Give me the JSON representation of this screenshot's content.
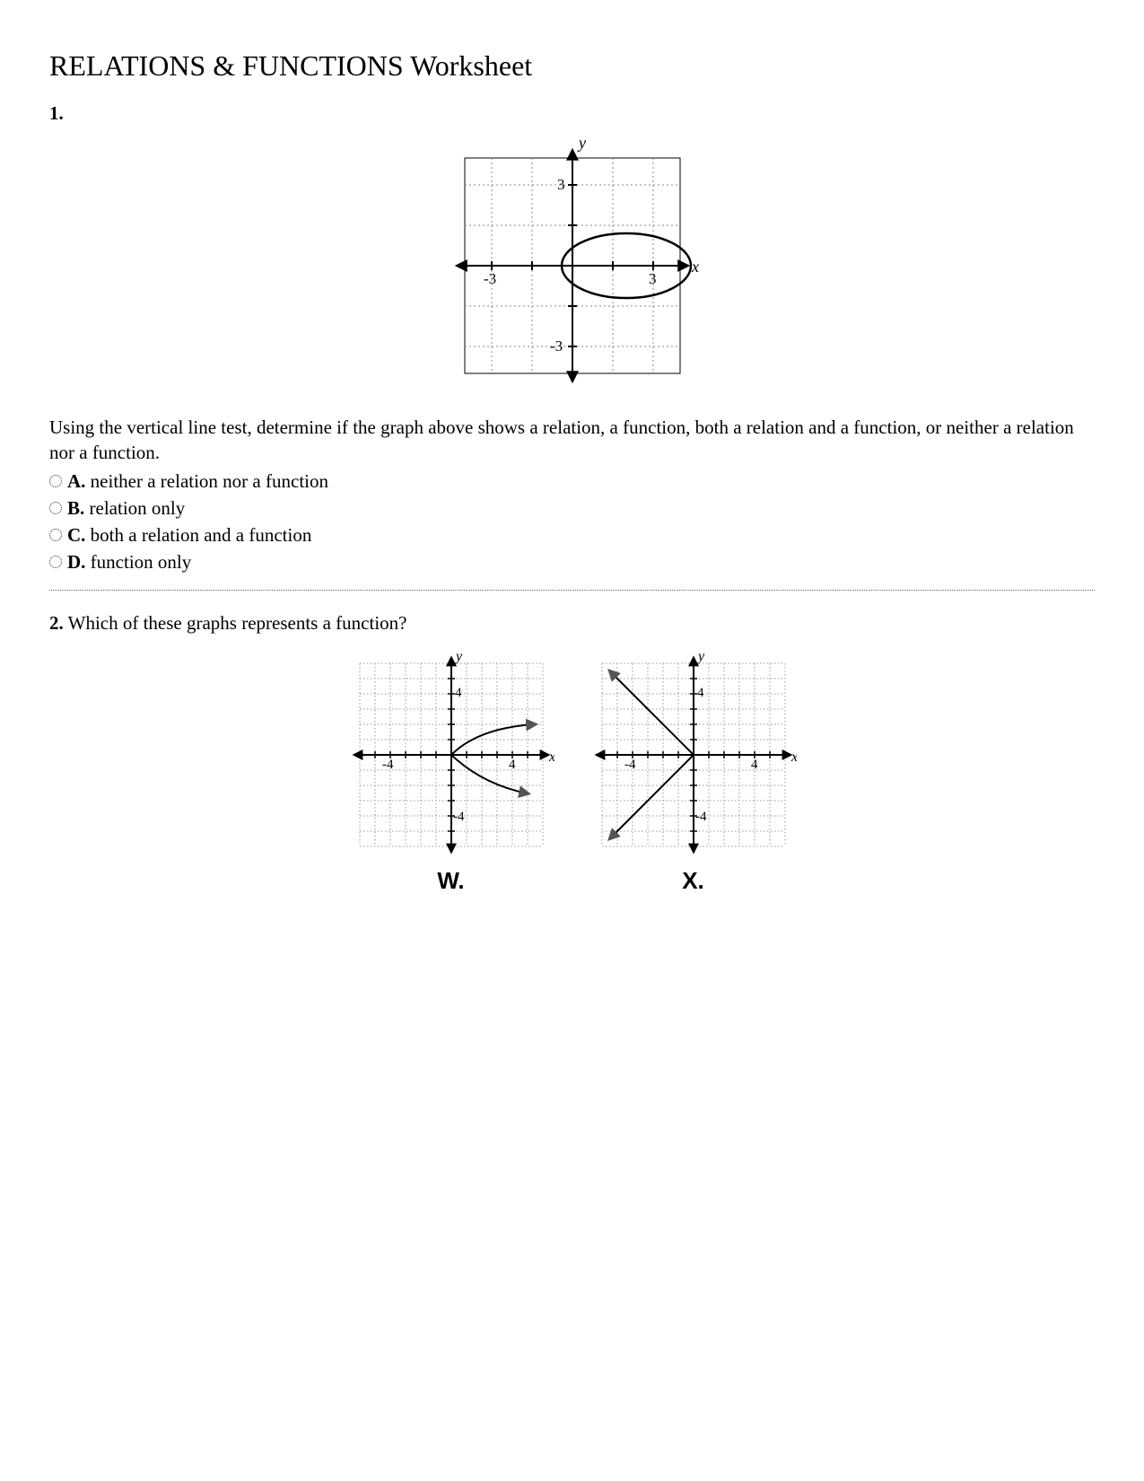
{
  "title": "RELATIONS & FUNCTIONS Worksheet",
  "q1": {
    "number": "1.",
    "text": "Using the vertical line test, determine if the graph above shows a relation, a function, both a relation and a function, or neither a relation nor a function.",
    "choices": {
      "a": {
        "label": "A.",
        "text": "neither a relation nor a function"
      },
      "b": {
        "label": "B.",
        "text": "relation only"
      },
      "c": {
        "label": "C.",
        "text": "both a relation and a function"
      },
      "d": {
        "label": "D.",
        "text": "function only"
      }
    },
    "graph": {
      "xlabel": "x",
      "ylabel": "y",
      "tick_pos_x": "3",
      "tick_neg_x": "-3",
      "tick_pos_y": "3",
      "tick_neg_y": "-3"
    }
  },
  "q2": {
    "number": "2.",
    "text": "Which of these graphs represents a function?",
    "graph_w": {
      "label": "W.",
      "xlabel": "x",
      "ylabel": "y",
      "tick_pos_x": "4",
      "tick_neg_x": "-4",
      "tick_pos_y": "4",
      "tick_neg_y": "-4"
    },
    "graph_x": {
      "label": "X.",
      "xlabel": "x",
      "ylabel": "y",
      "tick_pos_x": "4",
      "tick_neg_x": "-4",
      "tick_pos_y": "4",
      "tick_neg_y": "-4"
    }
  },
  "chart_data": [
    {
      "id": "q1-graph",
      "type": "coordinate-plane",
      "x_range": [
        -4.5,
        4.5
      ],
      "y_range": [
        -4.5,
        4.5
      ],
      "x_ticks": [
        -3,
        3
      ],
      "y_ticks": [
        -3,
        3
      ],
      "shapes": [
        {
          "kind": "ellipse",
          "cx": 2,
          "cy": 0,
          "rx": 2.4,
          "ry": 1.2
        }
      ]
    },
    {
      "id": "q2-graph-w",
      "type": "coordinate-plane",
      "x_range": [
        -6,
        6
      ],
      "y_range": [
        -6,
        6
      ],
      "x_ticks": [
        -4,
        4
      ],
      "y_ticks": [
        -4,
        4
      ],
      "curves": [
        {
          "kind": "sqrt-upper",
          "from": [
            0,
            0
          ],
          "to": [
            5.5,
            2
          ],
          "arrow_end": true
        },
        {
          "kind": "sqrt-lower",
          "from": [
            0,
            0
          ],
          "to": [
            5.5,
            -2.4
          ],
          "arrow_end": true
        }
      ]
    },
    {
      "id": "q2-graph-x",
      "type": "coordinate-plane",
      "x_range": [
        -6,
        6
      ],
      "y_range": [
        -6,
        6
      ],
      "x_ticks": [
        -4,
        4
      ],
      "y_ticks": [
        -4,
        4
      ],
      "lines": [
        {
          "from": [
            -5.5,
            5.5
          ],
          "to": [
            0,
            0
          ],
          "arrow_start": true
        },
        {
          "from": [
            -5.5,
            -5.5
          ],
          "to": [
            0,
            0
          ],
          "arrow_start": true
        }
      ]
    }
  ]
}
